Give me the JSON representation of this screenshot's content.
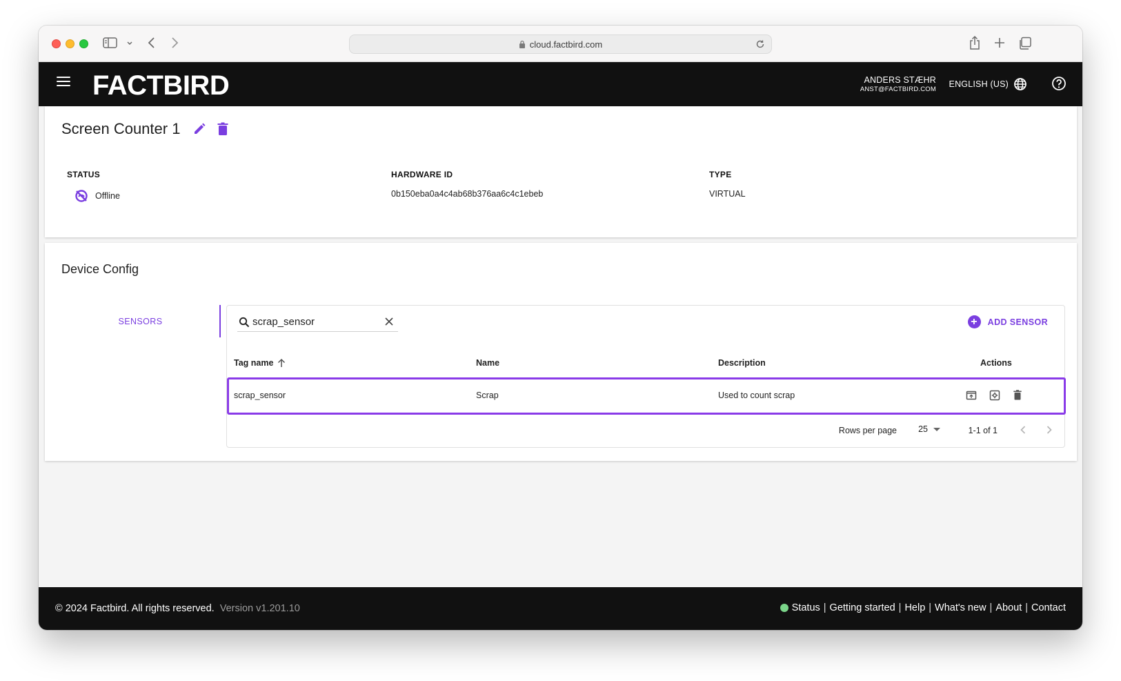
{
  "browser": {
    "url": "cloud.factbird.com"
  },
  "header": {
    "logo": "FACTBIRD",
    "user_name": "ANDERS STÆHR",
    "user_email": "ANST@FACTBIRD.COM",
    "language": "ENGLISH (US)"
  },
  "device": {
    "title": "Screen Counter 1",
    "status_label": "STATUS",
    "status_value": "Offline",
    "hardware_label": "HARDWARE ID",
    "hardware_value": "0b150eba0a4c4ab68b376aa6c4c1ebeb",
    "type_label": "TYPE",
    "type_value": "VIRTUAL"
  },
  "config": {
    "title": "Device Config",
    "tab_sensors": "SENSORS",
    "search_value": "scrap_sensor",
    "add_sensor": "ADD SENSOR",
    "columns": {
      "tag_name": "Tag name",
      "name": "Name",
      "description": "Description",
      "actions": "Actions"
    },
    "rows": [
      {
        "tag_name": "scrap_sensor",
        "name": "Scrap",
        "description": "Used to count scrap"
      }
    ],
    "rows_per_page_label": "Rows per page",
    "rows_per_page_value": "25",
    "range": "1-1 of 1"
  },
  "footer": {
    "copyright": "© 2024 Factbird. All rights reserved.",
    "version": "Version v1.201.10",
    "links": [
      "Status",
      "Getting started",
      "Help",
      "What's new",
      "About",
      "Contact"
    ]
  },
  "colors": {
    "accent": "#7a3ee0",
    "header_bg": "#111111",
    "status_dot": "#7bd58a"
  }
}
